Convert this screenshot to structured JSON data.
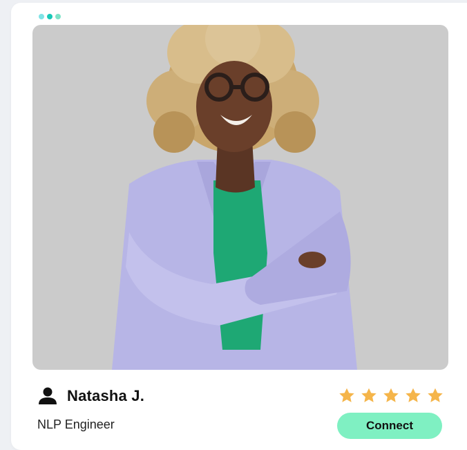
{
  "window": {
    "dots": [
      "#7fe3e6",
      "#18c9b8",
      "#7fe3c8"
    ]
  },
  "profile": {
    "photo_icon": "person-photo",
    "name": "Natasha J.",
    "name_icon": "user-icon",
    "role": "NLP Engineer",
    "rating": 5,
    "rating_max": 5,
    "star_icon": "star-icon"
  },
  "actions": {
    "connect_label": "Connect"
  },
  "colors": {
    "accent": "#7ff0c2",
    "star": "#f5b54a",
    "photo_background": "#cbcbcb",
    "jacket": "#b7b5e6",
    "shirt": "#1ea874"
  }
}
